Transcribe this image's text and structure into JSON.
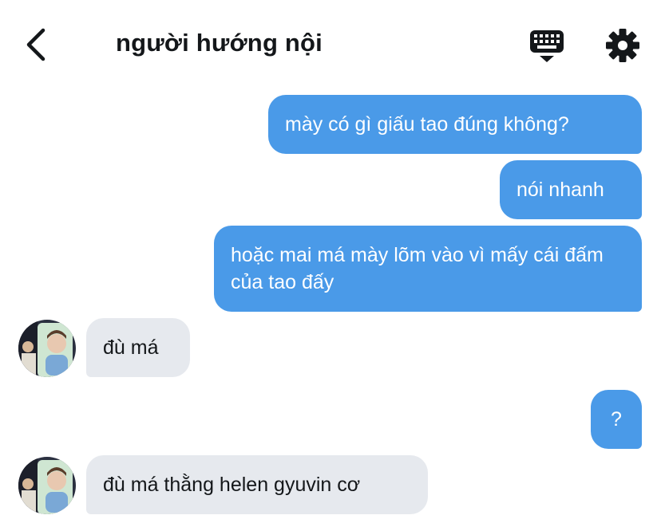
{
  "header": {
    "title": "người hướng nội",
    "back_icon": "chevron-left-icon",
    "keyboard_icon": "keyboard-icon",
    "settings_icon": "gear-icon"
  },
  "messages": [
    {
      "from": "me",
      "text": "mày có gì giấu tao đúng không?"
    },
    {
      "from": "me",
      "text": "nói nhanh"
    },
    {
      "from": "me",
      "text": "hoặc mai má mày lõm vào vì mấy cái đấm của tao đấy"
    },
    {
      "from": "them",
      "text": "đù má"
    },
    {
      "from": "me",
      "text": "?"
    },
    {
      "from": "them",
      "text": "đù má thằng helen gyuvin cơ"
    }
  ],
  "colors": {
    "outgoing_bubble": "#4a9ae8",
    "incoming_bubble": "#e6e9ee",
    "text_dark": "#14171a"
  }
}
